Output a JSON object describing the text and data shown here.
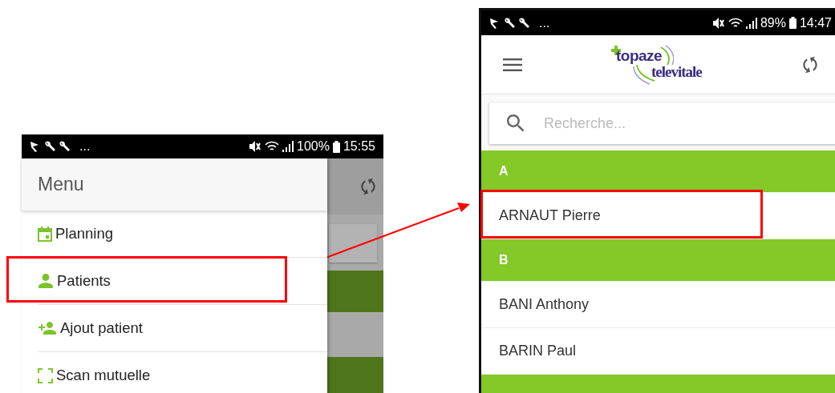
{
  "left_screen": {
    "status_bar": {
      "ellipsis": "...",
      "battery": "100%",
      "time": "15:55"
    },
    "menu": {
      "title": "Menu",
      "items": [
        {
          "kind": "calendar",
          "label": "Planning",
          "highlighted": false
        },
        {
          "kind": "person",
          "label": "Patients",
          "highlighted": true
        },
        {
          "kind": "person_add",
          "label": "Ajout patient",
          "highlighted": false
        },
        {
          "kind": "scan",
          "label": "Scan mutuelle",
          "highlighted": false
        }
      ]
    }
  },
  "right_screen": {
    "status_bar": {
      "ellipsis": "...",
      "battery": "89%",
      "time": "14:47"
    },
    "logo": {
      "line_1": "topaze",
      "line_2": "televitale"
    },
    "search": {
      "placeholder": "Recherche..."
    },
    "sections": [
      {
        "letter": "A",
        "patients": [
          {
            "name": "ARNAUT Pierre",
            "highlighted": true
          }
        ]
      },
      {
        "letter": "B",
        "patients": [
          {
            "name": "BANI Anthony",
            "highlighted": false
          },
          {
            "name": "BARIN Paul",
            "highlighted": false
          }
        ]
      }
    ]
  },
  "annotation": {
    "arrow": true
  }
}
